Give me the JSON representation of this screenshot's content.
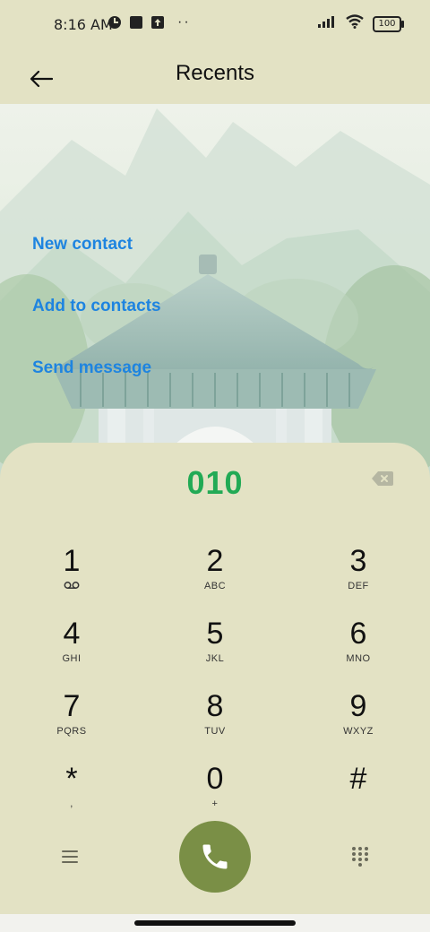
{
  "status": {
    "time": "8:16 AM",
    "battery": "100"
  },
  "header": {
    "title": "Recents"
  },
  "actions": [
    {
      "label": "New contact"
    },
    {
      "label": "Add to contacts"
    },
    {
      "label": "Send message"
    }
  ],
  "dial": {
    "number": "010",
    "keys": [
      {
        "digit": "1",
        "letters": ""
      },
      {
        "digit": "2",
        "letters": "ABC"
      },
      {
        "digit": "3",
        "letters": "DEF"
      },
      {
        "digit": "4",
        "letters": "GHI"
      },
      {
        "digit": "5",
        "letters": "JKL"
      },
      {
        "digit": "6",
        "letters": "MNO"
      },
      {
        "digit": "7",
        "letters": "PQRS"
      },
      {
        "digit": "8",
        "letters": "TUV"
      },
      {
        "digit": "9",
        "letters": "WXYZ"
      },
      {
        "digit": "*",
        "letters": ","
      },
      {
        "digit": "0",
        "letters": "+"
      },
      {
        "digit": "#",
        "letters": ""
      }
    ]
  },
  "colors": {
    "background": "#e3e2c4",
    "link": "#1e84e0",
    "number": "#22aa55",
    "call": "#7a8f46"
  }
}
